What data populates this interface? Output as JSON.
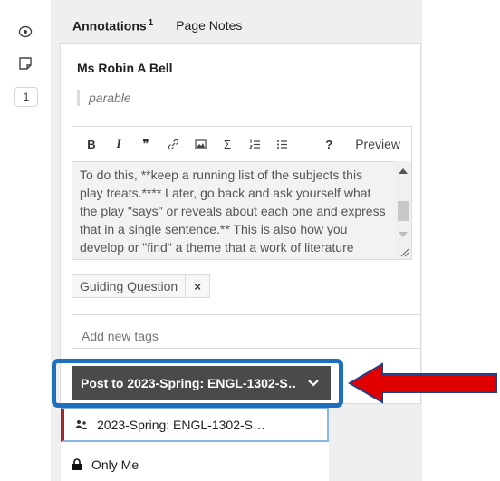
{
  "left_strip": {
    "eye_icon": "eye-icon",
    "note_icon": "page-note-icon",
    "annotation_count": "1"
  },
  "tabs": {
    "annotations_label": "Annotations",
    "annotations_count": "1",
    "page_notes_label": "Page Notes"
  },
  "annotation": {
    "author": "Ms Robin A Bell",
    "quote": "parable",
    "editor": {
      "toolbar": {
        "bold": "B",
        "italic": "I",
        "quote": "❞",
        "link": "link-icon",
        "image": "image-icon",
        "math": "Σ",
        "numbered_list": "numbered-list-icon",
        "bullet_list": "bullet-list-icon",
        "help": "?",
        "preview": "Preview"
      },
      "text": "To do this, **keep a running list of the subjects this play treats.**** Later, go back and ask yourself what the play \"says\" or reveals about each one and express that in a single sentence.** This is also how you develop or \"find\" a theme that a work of literature explores."
    },
    "tags": [
      "Guiding Question"
    ],
    "tag_remove": "×",
    "tag_input_placeholder": "Add new tags",
    "post_button": "Post to 2023-Spring: ENGL-1302-S…"
  },
  "dropdown": {
    "items": [
      {
        "label": "2023-Spring: ENGL-1302-S…",
        "icon": "group-icon"
      },
      {
        "label": "Only Me",
        "icon": "lock-icon"
      }
    ]
  },
  "colors": {
    "post_button_bg": "#4a4a4a",
    "callout_border": "#1f6fbf",
    "arrow_fill": "#e00000",
    "selected_left_border": "#a0282b"
  }
}
